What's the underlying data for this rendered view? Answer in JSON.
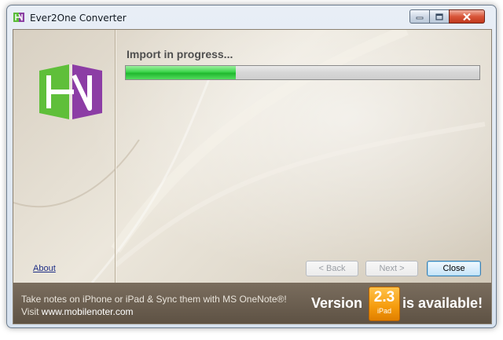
{
  "window": {
    "title": "Ever2One Converter",
    "icons": {
      "app": "ever2one-logo-icon",
      "minimize": "minimize-icon",
      "maximize": "maximize-icon",
      "close": "close-icon"
    }
  },
  "main": {
    "status_label": "Import in progress...",
    "progress": 0.31,
    "colors": {
      "progress_fill": "#2ecc40",
      "close_button": "#c0381c"
    }
  },
  "links": {
    "about": "About"
  },
  "buttons": {
    "back": "< Back",
    "next": "Next >",
    "close": "Close"
  },
  "footer": {
    "promo_line1": "Take notes on iPhone or iPad & Sync them with MS OneNote®!",
    "promo_visit": "Visit",
    "promo_domain": "www.mobilenoter.com",
    "version_prefix": "Version",
    "version_number": "2.3",
    "version_device": "iPad",
    "version_suffix": "is available!",
    "colors": {
      "badge": "#f59b0c",
      "background": "#6b5f50"
    }
  }
}
